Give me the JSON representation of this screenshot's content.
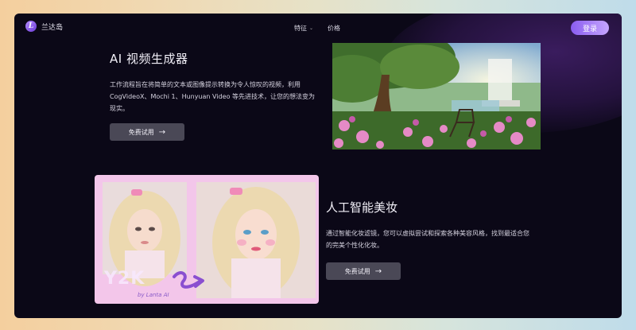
{
  "app": {
    "name": "兰达岛",
    "logo_letter": "L"
  },
  "nav": {
    "items": [
      {
        "label": "特征",
        "has_dropdown": true
      },
      {
        "label": "价格",
        "has_dropdown": false
      }
    ],
    "login_label": "登录"
  },
  "video_section": {
    "title": "AI 视频生成器",
    "description": "工作流程旨在将简单的文本或图像提示转换为令人惊叹的视频，利用 CogVideoX、Mochi 1、Hunyuan Video 等先进技术，让您的想法变为现实。",
    "cta_label": "免费试用",
    "cta_icon": "arrow-right-icon"
  },
  "makeup_section": {
    "title": "人工智能美妆",
    "description": "通过智能化妆滤镜，您可以虚拟尝试和探索各种美容风格，找到最适合您的完美个性化化妆。",
    "cta_label": "免费试用",
    "cta_icon": "arrow-right-icon",
    "image_text": "Y2K",
    "image_brand": "by Lanta AI"
  },
  "colors": {
    "accent": "#8a5cf0",
    "background": "#0b0817",
    "button": "#4a4856",
    "beauty_frame": "#f3c6ea"
  }
}
